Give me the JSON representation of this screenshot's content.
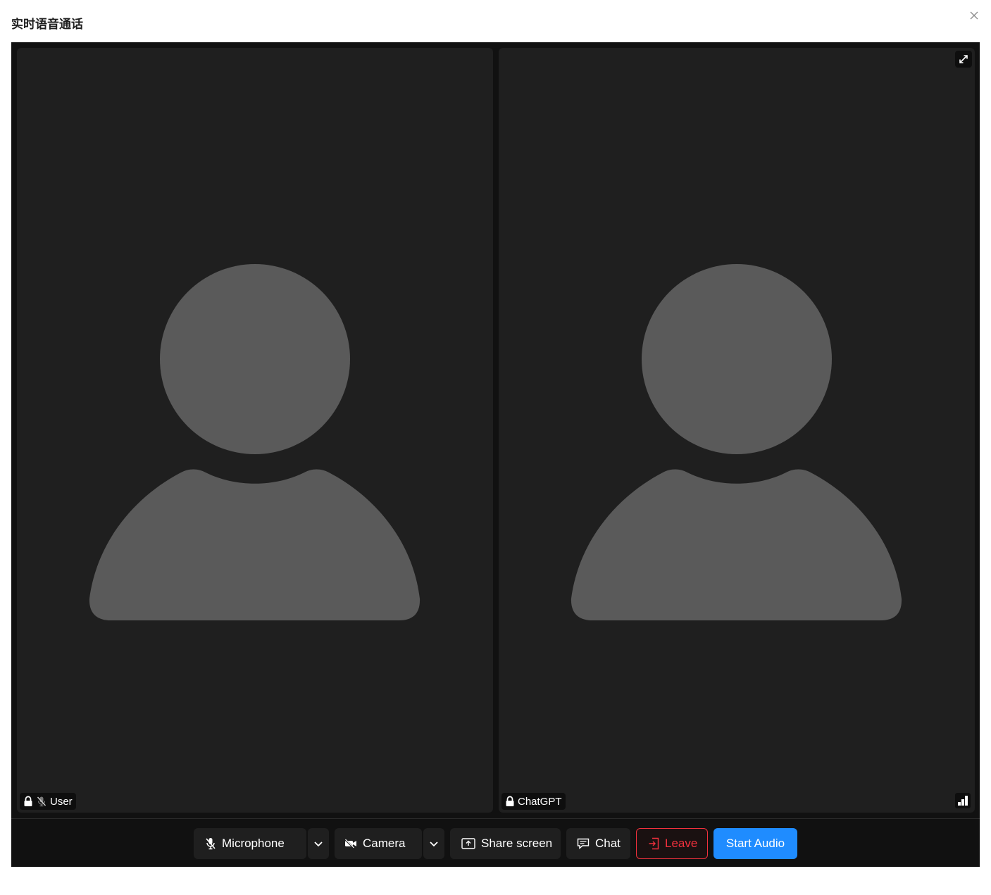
{
  "modal": {
    "title": "实时语音通话"
  },
  "participants": [
    {
      "name": "User"
    },
    {
      "name": "ChatGPT"
    }
  ],
  "controls": {
    "microphone_label": "Microphone",
    "camera_label": "Camera",
    "share_screen_label": "Share screen",
    "chat_label": "Chat",
    "leave_label": "Leave",
    "start_audio_label": "Start Audio"
  },
  "colors": {
    "room_bg": "#111111",
    "tile_bg": "#1f1f1f",
    "placeholder": "#5a5a5a",
    "leave": "#f2313d",
    "accent": "#1f8cff"
  },
  "icons": {
    "close": "close-icon",
    "lock": "lock-icon",
    "mic_off": "microphone-off-icon",
    "camera_off": "camera-off-icon",
    "share": "screen-share-icon",
    "chat": "chat-icon",
    "leave": "leave-icon",
    "chevron": "chevron-down-icon",
    "focus": "expand-icon",
    "quality": "connection-quality-icon"
  }
}
